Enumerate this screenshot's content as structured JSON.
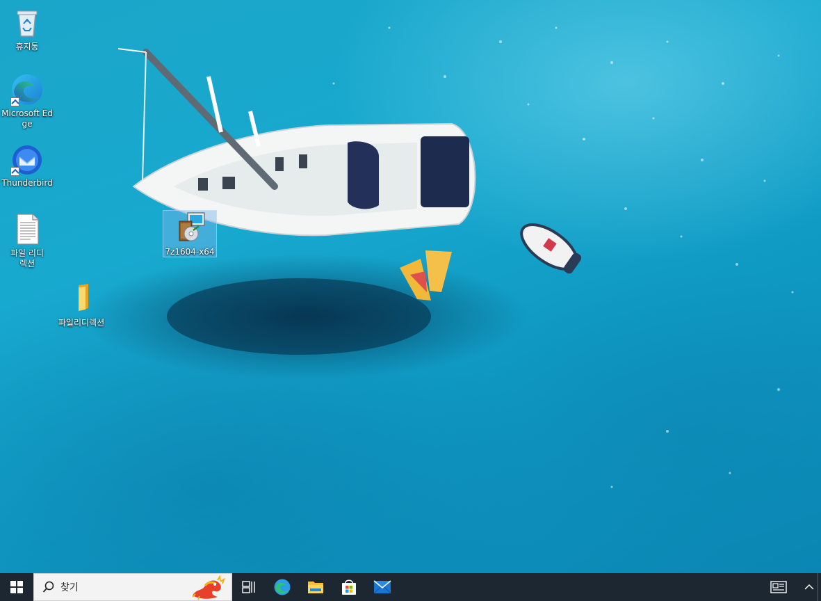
{
  "desktop": {
    "icons": [
      {
        "label": "휴지통"
      },
      {
        "label": "Microsoft Edge"
      },
      {
        "label": "Thunderbird"
      },
      {
        "label": "파일 리디렉션"
      },
      {
        "label": "파일리디렉션"
      },
      {
        "label": "7z1604-x64"
      }
    ]
  },
  "taskbar": {
    "search_placeholder": "찾기",
    "pinned": [
      {
        "name": "Task View"
      },
      {
        "name": "Microsoft Edge"
      },
      {
        "name": "File Explorer"
      },
      {
        "name": "Microsoft Store"
      },
      {
        "name": "Mail"
      }
    ],
    "colors": {
      "background": "#1c2731",
      "search_bg": "#f3f3f3"
    }
  }
}
